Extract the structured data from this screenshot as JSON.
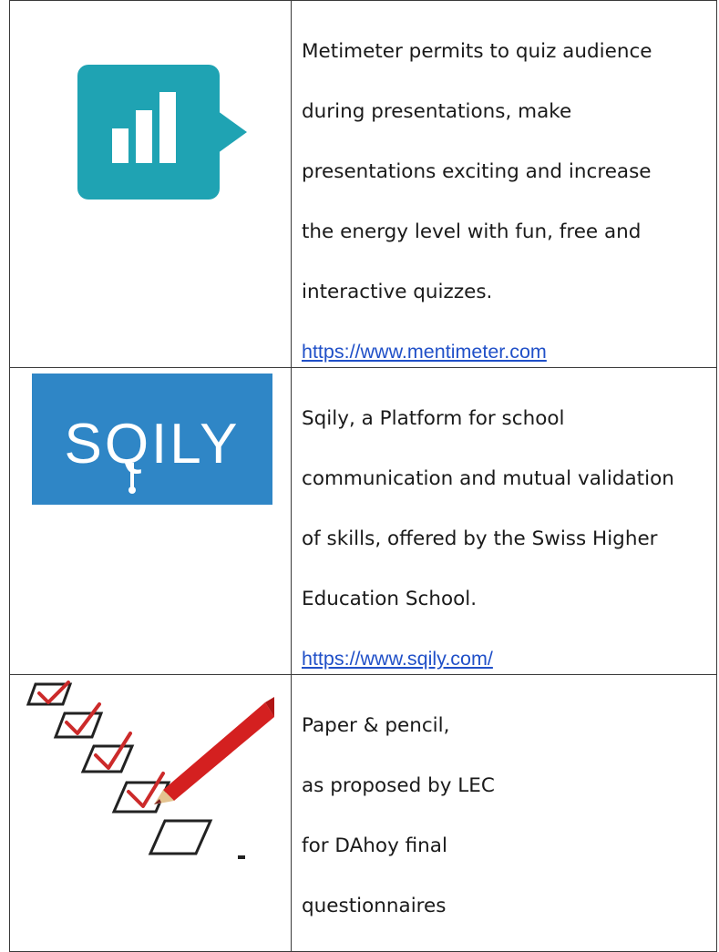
{
  "rows": [
    {
      "icon": "mentimeter-logo-icon",
      "lines": [
        "Metimeter permits to quiz audience",
        "during presentations, make",
        "presentations exciting and increase",
        "the energy level with fun, free and",
        "interactive quizzes."
      ],
      "link": "https://www.mentimeter.com"
    },
    {
      "icon": "sqily-logo-icon",
      "logo_text": "SQILY",
      "lines": [
        "Sqily, a Platform for school",
        "communication and mutual validation",
        "of skills, offered by the Swiss Higher",
        "Education School."
      ],
      "link": "https://www.sqily.com/"
    },
    {
      "icon": "checklist-pencil-icon",
      "lines": [
        "Paper & pencil,",
        "as proposed by LEC",
        "for DAhoy final",
        "questionnaires"
      ]
    }
  ],
  "colors": {
    "menti_teal": "#1fa3b3",
    "sqily_blue": "#2f86c6",
    "link_blue": "#2050c8",
    "check_red": "#cc2a2a",
    "pencil_red": "#d42020"
  }
}
